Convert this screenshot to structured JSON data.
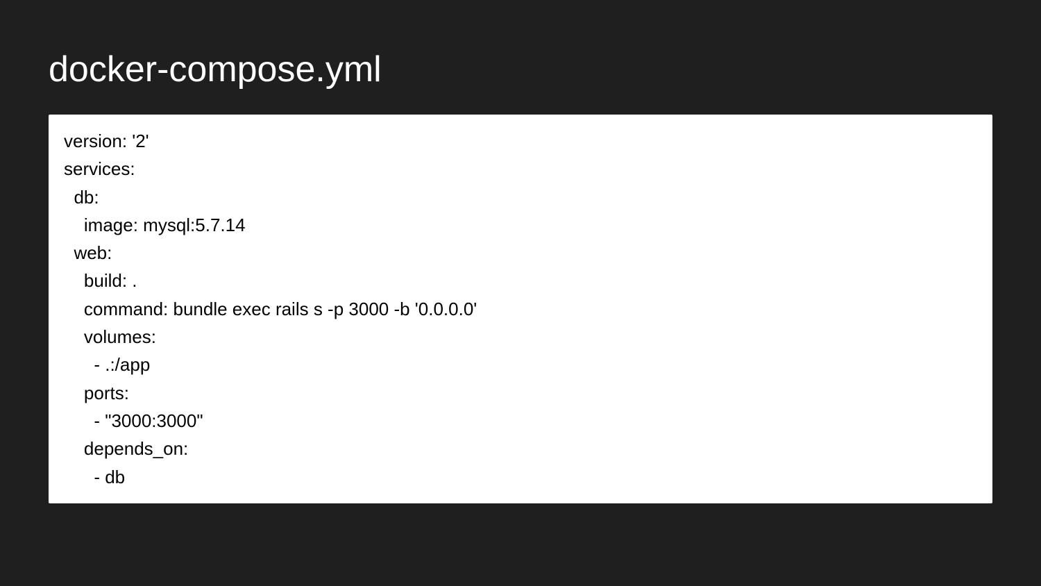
{
  "title": "docker-compose.yml",
  "code": "version: '2'\nservices:\n  db:\n    image: mysql:5.7.14\n  web:\n    build: .\n    command: bundle exec rails s -p 3000 -b '0.0.0.0'\n    volumes:\n      - .:/app\n    ports:\n      - \"3000:3000\"\n    depends_on:\n      - db"
}
